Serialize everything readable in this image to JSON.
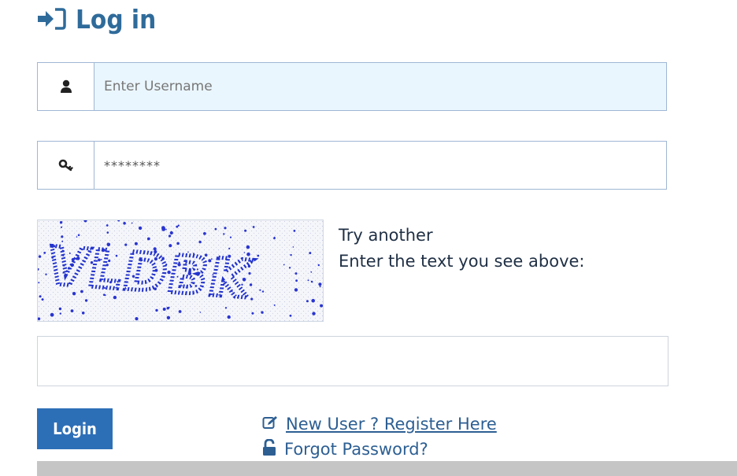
{
  "header": {
    "title": "Log in",
    "icon": "sign-in-icon"
  },
  "username": {
    "placeholder": "Enter Username",
    "value": "",
    "icon": "user-icon"
  },
  "password": {
    "value": "********",
    "icon": "key-icon"
  },
  "captcha": {
    "image_text": "VLDBK",
    "try_another_label": "Try another",
    "instruction": "Enter the text you see above:",
    "answer_value": ""
  },
  "actions": {
    "login_label": "Login",
    "register_label": "New User ? Register Here",
    "forgot_label": "Forgot Password?"
  },
  "colors": {
    "accent": "#2d6fb7",
    "title": "#2f6b9a",
    "username_bg": "#eaf6fd",
    "captcha_text": "#2233cc"
  }
}
